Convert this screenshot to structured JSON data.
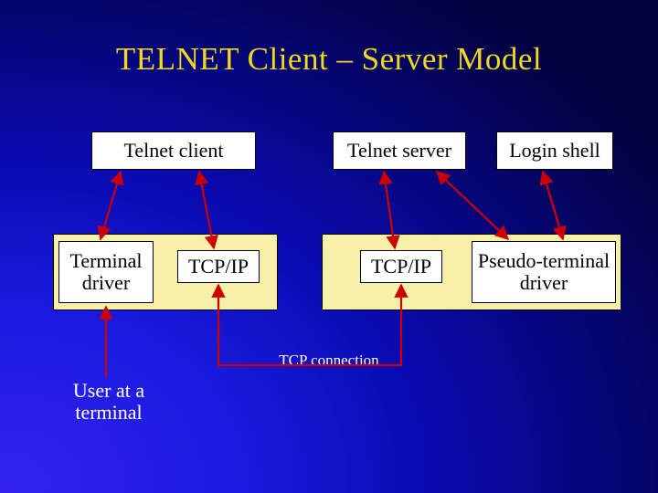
{
  "title": "TELNET Client – Server Model",
  "boxes": {
    "telnet_client": "Telnet client",
    "telnet_server": "Telnet server",
    "login_shell": "Login shell",
    "terminal_driver": "Terminal\ndriver",
    "tcpip_left": "TCP/IP",
    "tcpip_right": "TCP/IP",
    "pseudo_driver": "Pseudo-terminal\ndriver"
  },
  "labels": {
    "user_at_terminal": "User at a\nterminal",
    "tcp_connection": "TCP connection"
  },
  "colors": {
    "title": "#f0d820",
    "kernel_fill": "#f6f0a8",
    "arrow": "#cc0000"
  }
}
